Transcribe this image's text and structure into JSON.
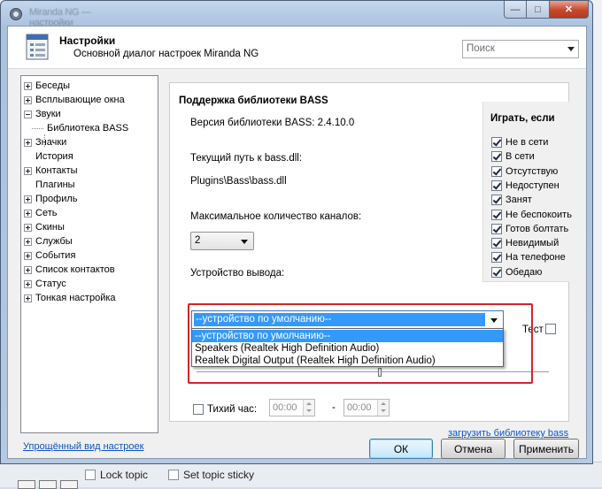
{
  "window": {
    "title_blurred": "Miranda NG — настройки",
    "header_title": "Настройки",
    "header_subtitle": "Основной диалог настроек Miranda NG",
    "search_placeholder": "Поиск"
  },
  "caption": {
    "minimize": "—",
    "maximize": "□",
    "close": "✕"
  },
  "tree": {
    "items": [
      {
        "label": "Беседы",
        "expander": "plus"
      },
      {
        "label": "Всплывающие окна",
        "expander": "plus"
      },
      {
        "label": "Звуки",
        "expander": "minus"
      },
      {
        "label": "Библиотека BASS",
        "expander": "none"
      },
      {
        "label": "Значки",
        "expander": "plus"
      },
      {
        "label": "История",
        "expander": "none"
      },
      {
        "label": "Контакты",
        "expander": "plus"
      },
      {
        "label": "Плагины",
        "expander": "none"
      },
      {
        "label": "Профиль",
        "expander": "plus"
      },
      {
        "label": "Сеть",
        "expander": "plus"
      },
      {
        "label": "Скины",
        "expander": "plus"
      },
      {
        "label": "Службы",
        "expander": "plus"
      },
      {
        "label": "События",
        "expander": "plus"
      },
      {
        "label": "Список контактов",
        "expander": "plus"
      },
      {
        "label": "Статус",
        "expander": "plus"
      },
      {
        "label": "Тонкая настройка",
        "expander": "plus"
      }
    ]
  },
  "pane": {
    "group_title": "Поддержка библиотеки BASS",
    "version_text": "Версия библиотеки BASS: 2.4.10.0",
    "path_label": "Текущий путь к bass.dll:",
    "path_value": "Plugins\\Bass\\bass.dll",
    "channels_label": "Максимальное количество каналов:",
    "channels_value": "2",
    "output_label": "Устройство вывода:",
    "device_selected": "--устройство по умолчанию--",
    "device_options": [
      "--устройство по умолчанию--",
      "Speakers (Realtek High Definition Audio)",
      "Realtek Digital Output (Realtek High Definition Audio)"
    ],
    "test_label": "Тест",
    "quiet_label": "Тихий час:",
    "quiet_from": "00:00",
    "quiet_dash": "-",
    "quiet_to": "00:00",
    "load_link": "загрузить библиотеку bass",
    "volume_fraction": 0.52
  },
  "play_if": {
    "title": "Играть, если",
    "items": [
      {
        "label": "Не в сети",
        "checked": true
      },
      {
        "label": "В сети",
        "checked": true
      },
      {
        "label": "Отсутствую",
        "checked": true
      },
      {
        "label": "Недоступен",
        "checked": true
      },
      {
        "label": "Занят",
        "checked": true
      },
      {
        "label": "Не беспокоить",
        "checked": true
      },
      {
        "label": "Готов болтать",
        "checked": true
      },
      {
        "label": "Невидимый",
        "checked": true
      },
      {
        "label": "На телефоне",
        "checked": true
      },
      {
        "label": "Обедаю",
        "checked": true
      }
    ]
  },
  "footer": {
    "simple_link": "Упрощённый вид настроек",
    "ok": "ОК",
    "cancel": "Отмена",
    "apply": "Применить"
  },
  "background": {
    "lock_topic": "Lock topic",
    "set_topic_sticky": "Set topic sticky",
    "left_fragment_1": "I",
    "left_fragment_2": "N"
  }
}
